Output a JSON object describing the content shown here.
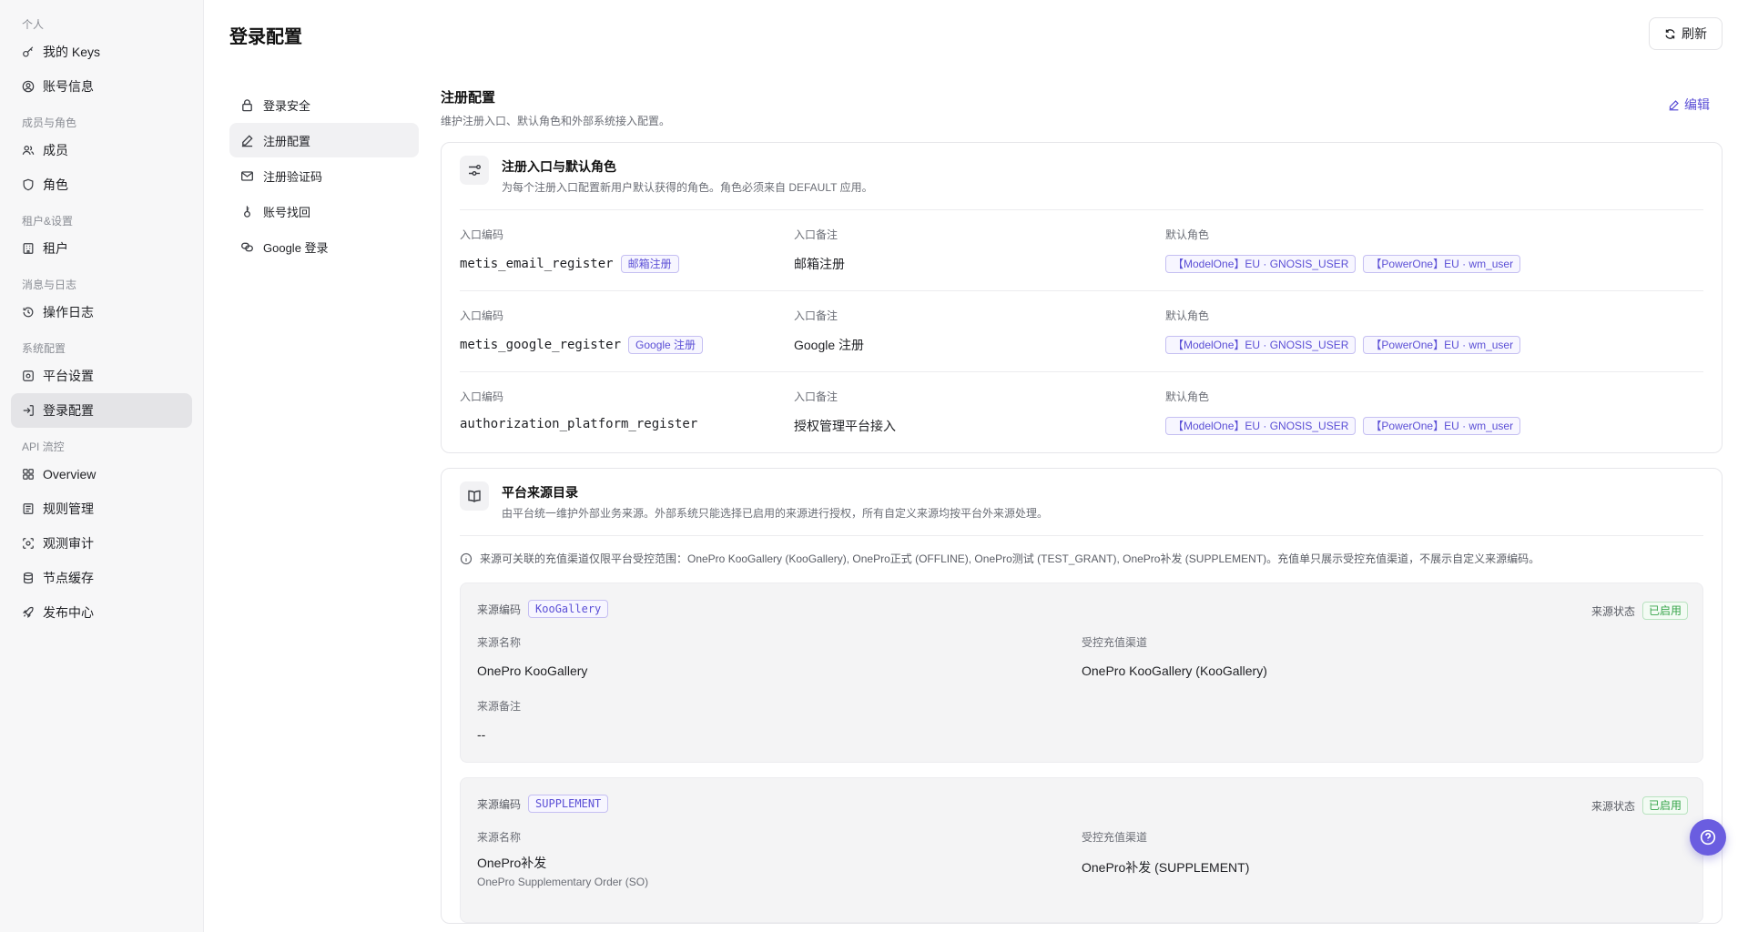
{
  "sidebar": {
    "groups": [
      {
        "label": "个人",
        "items": [
          {
            "label": "我的 Keys"
          },
          {
            "label": "账号信息"
          }
        ]
      },
      {
        "label": "成员与角色",
        "items": [
          {
            "label": "成员"
          },
          {
            "label": "角色"
          }
        ]
      },
      {
        "label": "租户&设置",
        "items": [
          {
            "label": "租户"
          }
        ]
      },
      {
        "label": "消息与日志",
        "items": [
          {
            "label": "操作日志"
          }
        ]
      },
      {
        "label": "系统配置",
        "items": [
          {
            "label": "平台设置"
          },
          {
            "label": "登录配置"
          }
        ]
      },
      {
        "label": "API 流控",
        "items": [
          {
            "label": "Overview"
          },
          {
            "label": "规则管理"
          },
          {
            "label": "观测审计"
          },
          {
            "label": "节点缓存"
          },
          {
            "label": "发布中心"
          }
        ]
      }
    ]
  },
  "header": {
    "title": "登录配置",
    "refresh_label": "刷新"
  },
  "subnav": {
    "items": [
      {
        "label": "登录安全"
      },
      {
        "label": "注册配置"
      },
      {
        "label": "注册验证码"
      },
      {
        "label": "账号找回"
      },
      {
        "label": "Google 登录"
      }
    ]
  },
  "section": {
    "title": "注册配置",
    "desc": "维护注册入口、默认角色和外部系统接入配置。",
    "edit_label": "编辑"
  },
  "register_card": {
    "title": "注册入口与默认角色",
    "desc": "为每个注册入口配置新用户默认获得的角色。角色必须来自 DEFAULT 应用。",
    "col_code": "入口编码",
    "col_note": "入口备注",
    "col_roles": "默认角色",
    "rows": [
      {
        "code": "metis_email_register",
        "tag": "邮箱注册",
        "note": "邮箱注册",
        "roles": [
          "【ModelOne】EU · GNOSIS_USER",
          "【PowerOne】EU · wm_user"
        ]
      },
      {
        "code": "metis_google_register",
        "tag": "Google 注册",
        "note": "Google 注册",
        "roles": [
          "【ModelOne】EU · GNOSIS_USER",
          "【PowerOne】EU · wm_user"
        ]
      },
      {
        "code": "authorization_platform_register",
        "tag": "",
        "note": "授权管理平台接入",
        "roles": [
          "【ModelOne】EU · GNOSIS_USER",
          "【PowerOne】EU · wm_user"
        ]
      }
    ]
  },
  "source_card": {
    "title": "平台来源目录",
    "desc": "由平台统一维护外部业务来源。外部系统只能选择已启用的来源进行授权，所有自定义来源均按平台外来源处理。",
    "notice": "来源可关联的充值渠道仅限平台受控范围：OnePro KooGallery (KooGallery), OnePro正式 (OFFLINE), OnePro测试 (TEST_GRANT), OnePro补发 (SUPPLEMENT)。充值单只展示受控充值渠道，不展示自定义来源编码。",
    "labels": {
      "code": "来源编码",
      "status": "来源状态",
      "name": "来源名称",
      "channel": "受控充值渠道",
      "note": "来源备注"
    },
    "sources": [
      {
        "code": "KooGallery",
        "status": "已启用",
        "name": "OnePro KooGallery",
        "name_sub": "",
        "channel": "OnePro KooGallery (KooGallery)",
        "note": "--"
      },
      {
        "code": "SUPPLEMENT",
        "status": "已启用",
        "name": "OnePro补发",
        "name_sub": "OnePro Supplementary Order (SO)",
        "channel": "OnePro补发 (SUPPLEMENT)",
        "note": ""
      }
    ]
  }
}
